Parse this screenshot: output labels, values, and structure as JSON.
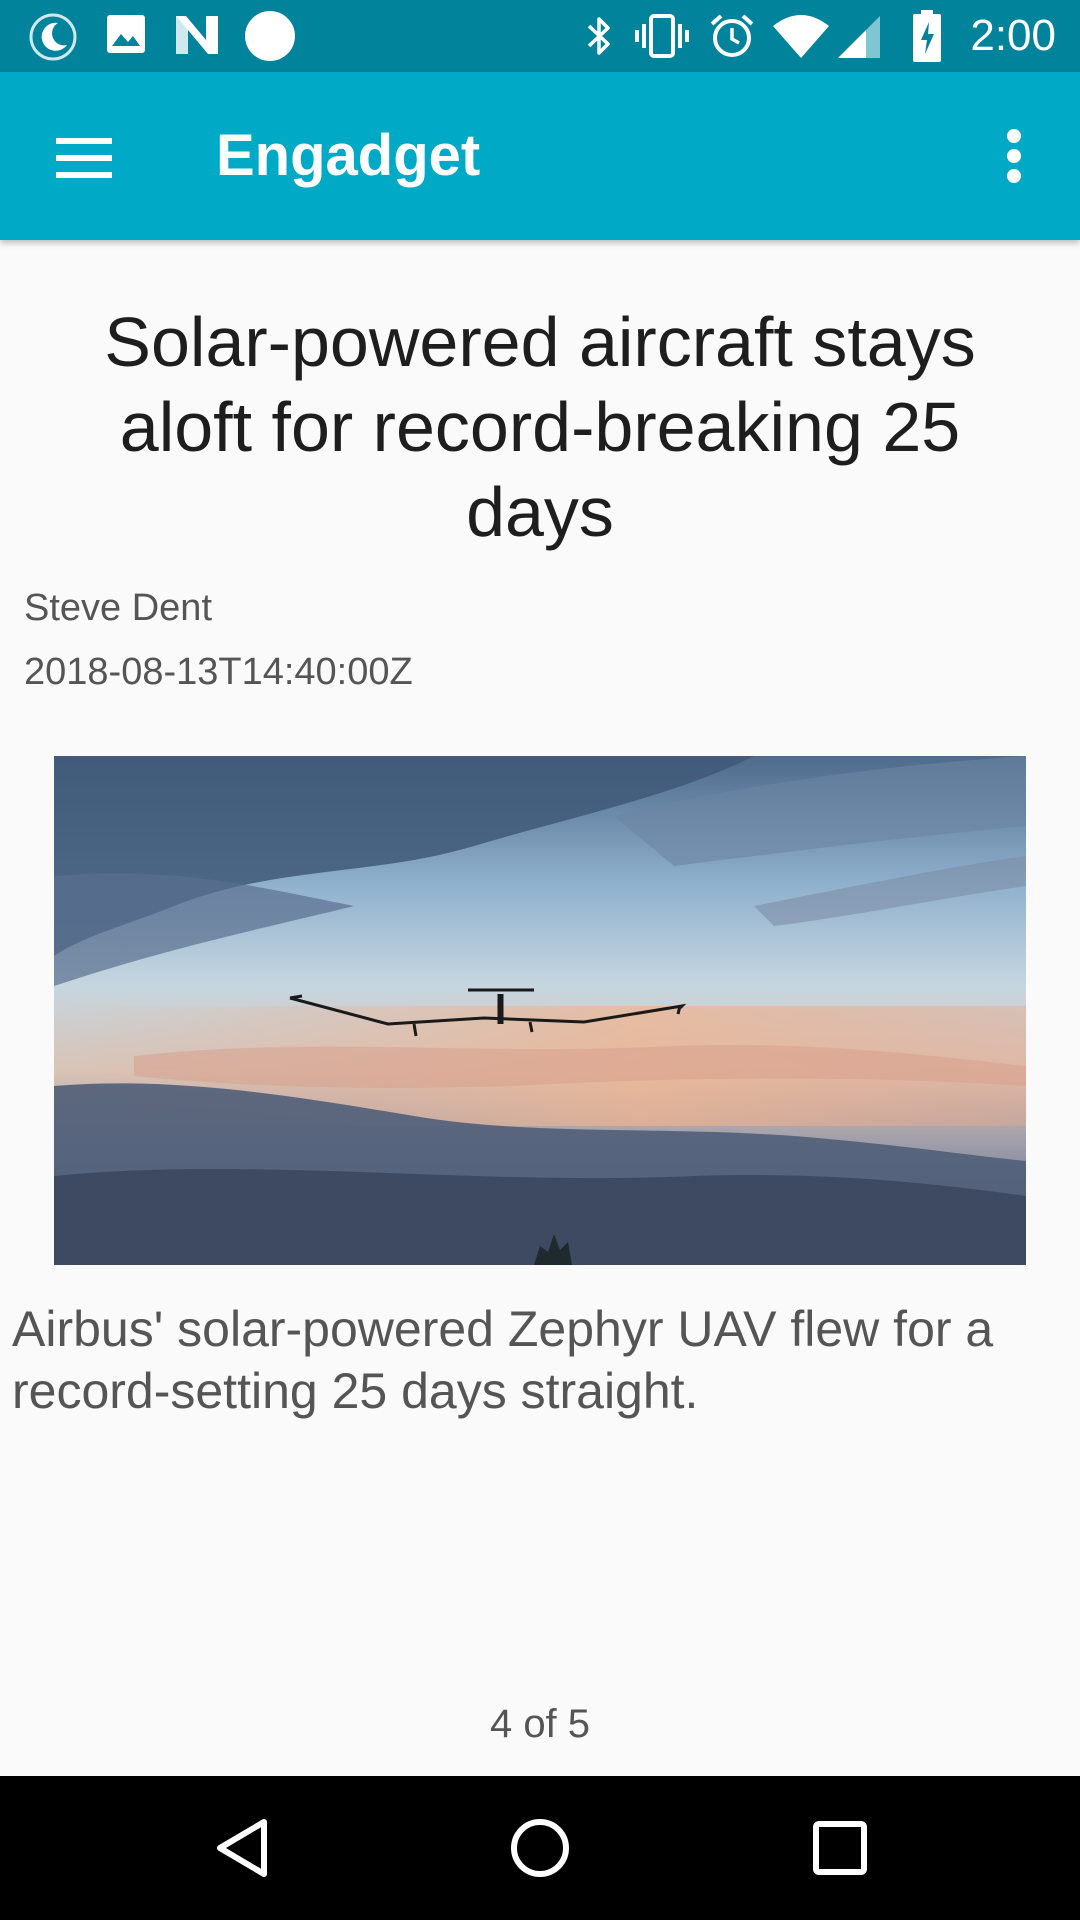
{
  "status_bar": {
    "time": "2:00",
    "left_icons": [
      "do-not-disturb-icon",
      "image-icon",
      "n-app-icon",
      "circle-icon"
    ],
    "right_icons": [
      "bluetooth-icon",
      "vibrate-icon",
      "alarm-icon",
      "wifi-icon",
      "signal-icon",
      "battery-charging-icon"
    ]
  },
  "app_bar": {
    "title": "Engadget",
    "color": "#00a9c6"
  },
  "article": {
    "headline": "Solar-powered aircraft stays aloft for record-breaking 25 days",
    "author": "Steve Dent",
    "published": "2018-08-13T14:40:00Z",
    "summary": "Airbus' solar-powered Zephyr UAV flew for a record-setting 25 days straight."
  },
  "pager": {
    "label": "4 of 5",
    "current": 4,
    "total": 5
  },
  "nav_bar": {
    "buttons": [
      "back-icon",
      "home-icon",
      "recents-icon"
    ]
  }
}
